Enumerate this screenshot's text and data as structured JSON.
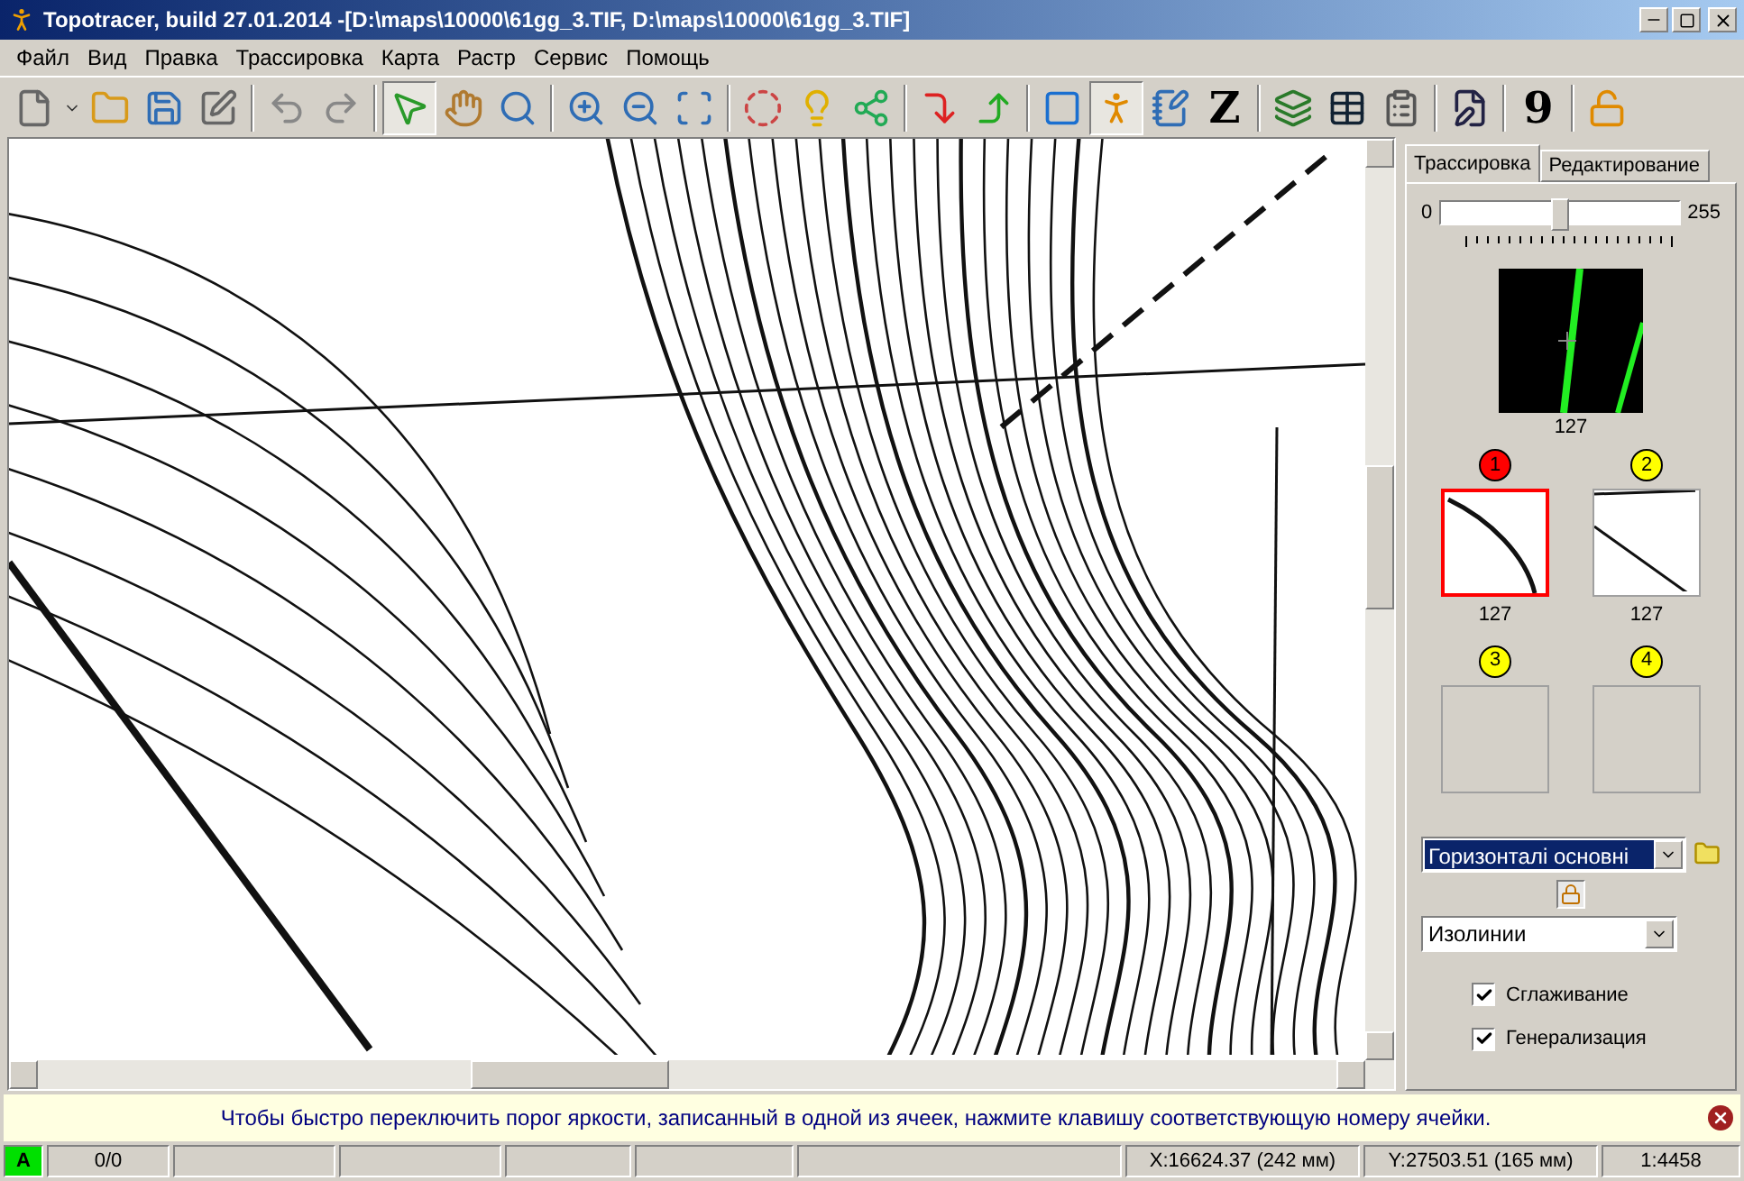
{
  "window": {
    "title": "Topotracer, build 27.01.2014 -[D:\\maps\\10000\\61gg_3.TIF, D:\\maps\\10000\\61gg_3.TIF]"
  },
  "menu": [
    "Файл",
    "Вид",
    "Правка",
    "Трассировка",
    "Карта",
    "Растр",
    "Сервис",
    "Помощь"
  ],
  "toolbar": [
    {
      "kind": "icon",
      "selected": false
    },
    {
      "kind": "icon",
      "selected": false
    },
    {
      "kind": "icon",
      "selected": false
    },
    {
      "kind": "icon",
      "selected": false
    },
    {
      "kind": "icon",
      "selected": false
    },
    {
      "kind": "sep"
    },
    {
      "kind": "icon",
      "selected": false
    },
    {
      "kind": "icon",
      "selected": false
    },
    {
      "kind": "sep"
    },
    {
      "kind": "icon",
      "selected": true
    },
    {
      "kind": "icon",
      "selected": false
    },
    {
      "kind": "icon",
      "selected": false
    },
    {
      "kind": "sep"
    },
    {
      "kind": "icon",
      "selected": false
    },
    {
      "kind": "icon",
      "selected": false
    },
    {
      "kind": "icon",
      "selected": false
    },
    {
      "kind": "sep"
    },
    {
      "kind": "icon",
      "selected": false
    },
    {
      "kind": "icon",
      "selected": false
    },
    {
      "kind": "icon",
      "selected": false
    },
    {
      "kind": "sep"
    },
    {
      "kind": "icon",
      "selected": false
    },
    {
      "kind": "icon",
      "selected": false
    },
    {
      "kind": "sep"
    },
    {
      "kind": "icon",
      "selected": false
    },
    {
      "kind": "icon",
      "selected": true
    },
    {
      "kind": "icon",
      "selected": false
    },
    {
      "kind": "text",
      "text": "Z",
      "selected": false
    },
    {
      "kind": "sep"
    },
    {
      "kind": "icon",
      "selected": false
    },
    {
      "kind": "icon",
      "selected": false
    },
    {
      "kind": "icon",
      "selected": false
    },
    {
      "kind": "sep"
    },
    {
      "kind": "icon",
      "selected": false
    },
    {
      "kind": "sep"
    },
    {
      "kind": "text",
      "text": "9",
      "selected": false
    },
    {
      "kind": "sep"
    },
    {
      "kind": "icon",
      "selected": false
    }
  ],
  "tabs": [
    {
      "label": "Трассировка",
      "selected": true
    },
    {
      "label": "Редактирование",
      "selected": false
    }
  ],
  "threshold": {
    "min": "0",
    "max": "255",
    "level": 0.5
  },
  "preview": {
    "value": "127"
  },
  "cells": [
    {
      "number": "1",
      "color": "#ff0000",
      "selected": true,
      "kind": "curve",
      "value": "127"
    },
    {
      "number": "2",
      "color": "#ffff00",
      "selected": false,
      "kind": "label",
      "value": "127"
    },
    {
      "number": "3",
      "color": "#ffff00",
      "selected": false,
      "kind": "empty"
    },
    {
      "number": "4",
      "color": "#ffff00",
      "selected": false,
      "kind": "empty"
    }
  ],
  "layer_select": {
    "value": "Горизонталі основні"
  },
  "type_select": {
    "value": "Изолинии"
  },
  "options": [
    {
      "label": "Сглаживание",
      "checked": true
    },
    {
      "label": "Генерализация",
      "checked": true
    }
  ],
  "hint": "Чтобы быстро переключить порог яркости, записанный в одной из ячеек, нажмите клавишу соответствующую номеру ячейки.",
  "status_bar": {
    "mode": "A",
    "count": "0/0",
    "x": "X:16624.37 (242 мм)",
    "y": "Y:27503.51 (165 мм)",
    "scale": "1:4458"
  }
}
